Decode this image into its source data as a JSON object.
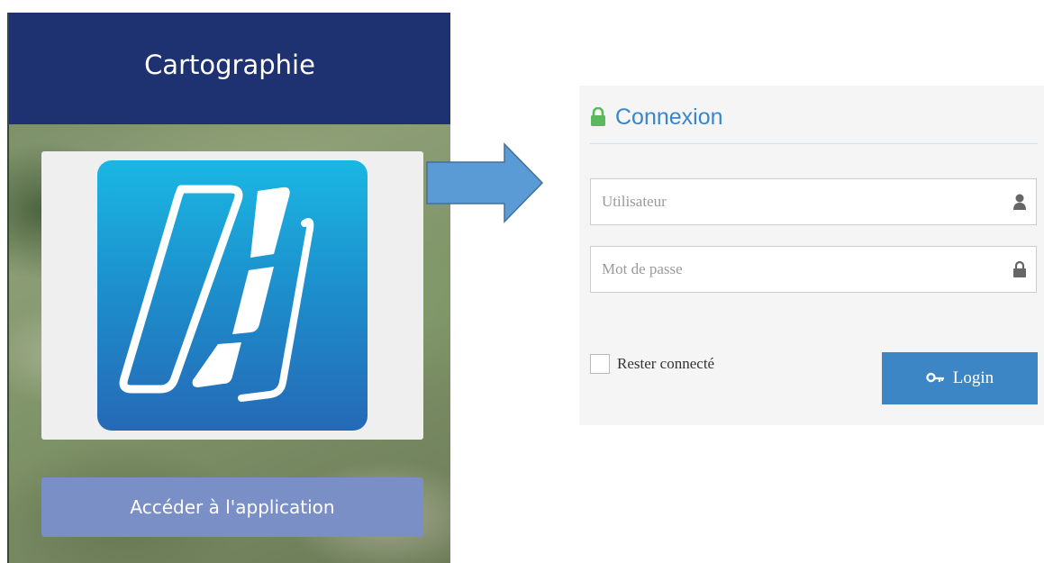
{
  "app_card": {
    "title": "Cartographie",
    "logo_icon": "map-layers-icon",
    "access_button": "Accéder à l'application",
    "header_color": "#1e3170",
    "button_color": "#7a8fc6"
  },
  "arrow": {
    "icon": "right-arrow-icon",
    "color": "#5b9bd5"
  },
  "login": {
    "title": "Connexion",
    "title_icon": "lock-icon",
    "username_placeholder": "Utilisateur",
    "username_icon": "user-icon",
    "password_placeholder": "Mot de passe",
    "password_icon": "lock-icon",
    "remember_label": "Rester connecté",
    "login_button": "Login",
    "login_icon": "key-icon",
    "accent_color": "#3c86c6",
    "lock_color": "#5cb85c"
  }
}
